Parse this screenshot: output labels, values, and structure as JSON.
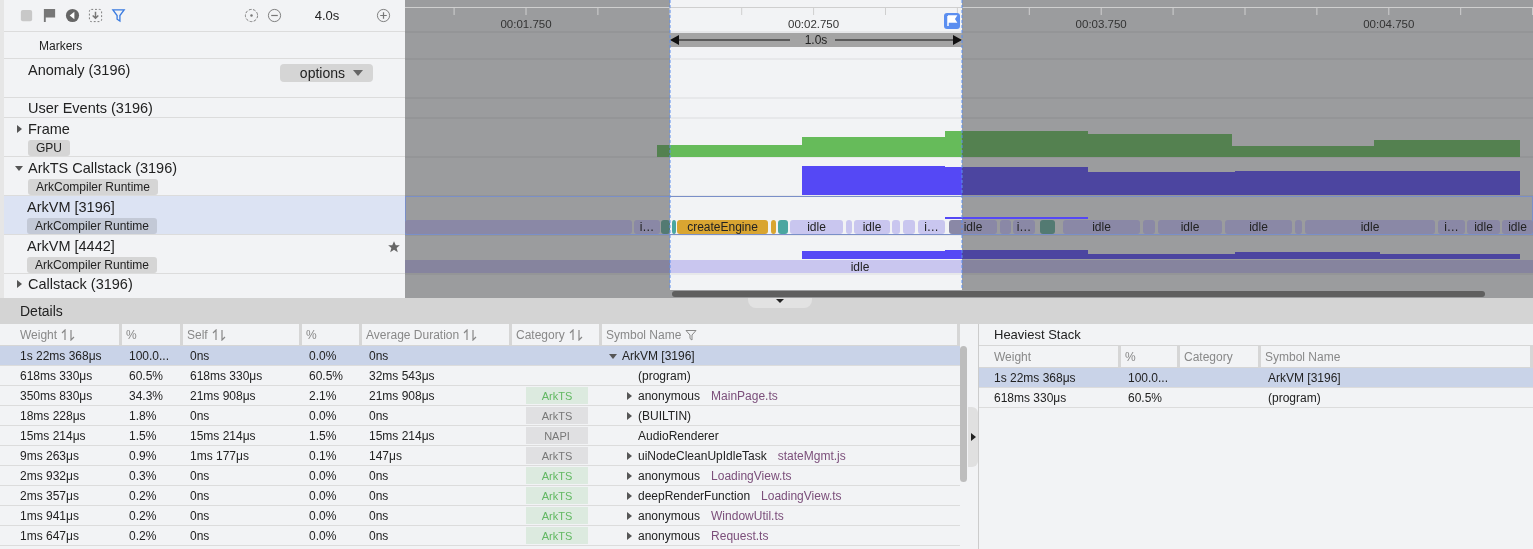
{
  "toolbar": {
    "zoom": "4.0s"
  },
  "lanes": [
    {
      "kind": "label",
      "title": "Markers",
      "selected": false
    },
    {
      "kind": "track",
      "title": "Anomaly (3196)",
      "dropdown": "options",
      "selected": false
    },
    {
      "kind": "track",
      "title": "User Events (3196)",
      "selected": false
    },
    {
      "kind": "track",
      "title": "Frame",
      "tag": "GPU",
      "expanded": false,
      "selected": false
    },
    {
      "kind": "track",
      "title": "ArkTS Callstack (3196)",
      "tag": "ArkCompiler Runtime",
      "expanded": true,
      "selected": false,
      "children": [
        {
          "title": "ArkVM [3196]",
          "tag": "ArkCompiler Runtime",
          "selected": true,
          "starred": false
        },
        {
          "title": "ArkVM [4442]",
          "tag": "ArkCompiler Runtime",
          "selected": false,
          "starred": true
        }
      ]
    },
    {
      "kind": "track",
      "title": "Callstack (3196)",
      "expanded": false,
      "selected": false
    }
  ],
  "timeline": {
    "ticks": [
      "00:01.750",
      "00:02.750",
      "00:03.750",
      "00:04.750"
    ],
    "selection": {
      "duration": "1.0s"
    },
    "slices": [
      {
        "kind": "idle"
      },
      {
        "kind": "idle",
        "label": "i…"
      },
      {
        "kind": "native"
      },
      {
        "kind": "native"
      },
      {
        "kind": "engine",
        "label": "createEngine"
      },
      {
        "kind": "engine"
      },
      {
        "kind": "native"
      },
      {
        "kind": "idle",
        "label": "idle"
      },
      {
        "kind": "idle"
      },
      {
        "kind": "idle",
        "label": "idle"
      },
      {
        "kind": "idle"
      },
      {
        "kind": "idle"
      },
      {
        "kind": "idle",
        "label": "i…"
      },
      {
        "kind": "idle",
        "label": "idle"
      },
      {
        "kind": "idle"
      },
      {
        "kind": "idle",
        "label": "i…"
      },
      {
        "kind": "native"
      },
      {
        "kind": "idle",
        "label": "idle"
      },
      {
        "kind": "idle"
      },
      {
        "kind": "idle",
        "label": "idle"
      },
      {
        "kind": "idle",
        "label": "idle"
      },
      {
        "kind": "idle"
      },
      {
        "kind": "idle",
        "label": "idle"
      },
      {
        "kind": "idle",
        "label": "i…"
      },
      {
        "kind": "idle",
        "label": "idle"
      },
      {
        "kind": "idle",
        "label": "idle"
      }
    ],
    "idle_bar": "idle"
  },
  "details": {
    "title": "Details",
    "columns": [
      "Weight",
      "%",
      "Self",
      "%",
      "Average Duration",
      "Category",
      "Symbol Name"
    ],
    "rows": [
      {
        "weight": "1s 22ms 368μs",
        "weight_pct": "100.0...",
        "self": "0ns",
        "self_pct": "0.0%",
        "avg": "0ns",
        "symbol": "ArkVM [3196]",
        "expanded": true,
        "selected": true,
        "children": [
          {
            "weight": "618ms 330μs",
            "weight_pct": "60.5%",
            "self": "618ms 330μs",
            "self_pct": "60.5%",
            "avg": "32ms 543μs",
            "symbol": "(program)",
            "selected": false
          },
          {
            "weight": "350ms 830μs",
            "weight_pct": "34.3%",
            "self": "21ms 908μs",
            "self_pct": "2.1%",
            "avg": "21ms 908μs",
            "category": {
              "label": "ArkTS",
              "color": "#62b862"
            },
            "symbol": "anonymous",
            "file": "MainPage.ts",
            "expanded": false,
            "selected": false
          },
          {
            "weight": "18ms 228μs",
            "weight_pct": "1.8%",
            "self": "0ns",
            "self_pct": "0.0%",
            "avg": "0ns",
            "category": {
              "label": "ArkTS",
              "color": "#777777"
            },
            "symbol": "(BUILTIN)",
            "expanded": false,
            "selected": false
          },
          {
            "weight": "15ms 214μs",
            "weight_pct": "1.5%",
            "self": "15ms 214μs",
            "self_pct": "1.5%",
            "avg": "15ms 214μs",
            "category": {
              "label": "NAPI",
              "color": "#777777"
            },
            "symbol": "AudioRenderer",
            "selected": false
          },
          {
            "weight": "9ms 263μs",
            "weight_pct": "0.9%",
            "self": "1ms 177μs",
            "self_pct": "0.1%",
            "avg": "147μs",
            "category": {
              "label": "ArkTS",
              "color": "#777777"
            },
            "symbol": "uiNodeCleanUpIdleTask",
            "file": "stateMgmt.js",
            "expanded": false,
            "selected": false
          },
          {
            "weight": "2ms 932μs",
            "weight_pct": "0.3%",
            "self": "0ns",
            "self_pct": "0.0%",
            "avg": "0ns",
            "category": {
              "label": "ArkTS",
              "color": "#62b862"
            },
            "symbol": "anonymous",
            "file": "LoadingView.ts",
            "expanded": false,
            "selected": false
          },
          {
            "weight": "2ms 357μs",
            "weight_pct": "0.2%",
            "self": "0ns",
            "self_pct": "0.0%",
            "avg": "0ns",
            "category": {
              "label": "ArkTS",
              "color": "#62b862"
            },
            "symbol": "deepRenderFunction",
            "file": "LoadingView.ts",
            "expanded": false,
            "selected": false
          },
          {
            "weight": "1ms 941μs",
            "weight_pct": "0.2%",
            "self": "0ns",
            "self_pct": "0.0%",
            "avg": "0ns",
            "category": {
              "label": "ArkTS",
              "color": "#62b862"
            },
            "symbol": "anonymous",
            "file": "WindowUtil.ts",
            "expanded": false,
            "selected": false
          },
          {
            "weight": "1ms 647μs",
            "weight_pct": "0.2%",
            "self": "0ns",
            "self_pct": "0.0%",
            "avg": "0ns",
            "category": {
              "label": "ArkTS",
              "color": "#62b862"
            },
            "symbol": "anonymous",
            "file": "Request.ts",
            "expanded": false,
            "selected": false
          }
        ]
      }
    ]
  },
  "heaviest_stack": {
    "title": "Heaviest Stack",
    "columns": [
      "Weight",
      "%",
      "Category",
      "Symbol Name"
    ],
    "rows": [
      {
        "weight": "1s 22ms 368μs",
        "pct": "100.0...",
        "symbol": "ArkVM [3196]",
        "selected": true
      },
      {
        "weight": "618ms 330μs",
        "pct": "60.5%",
        "symbol": "(program)",
        "selected": false
      }
    ]
  }
}
